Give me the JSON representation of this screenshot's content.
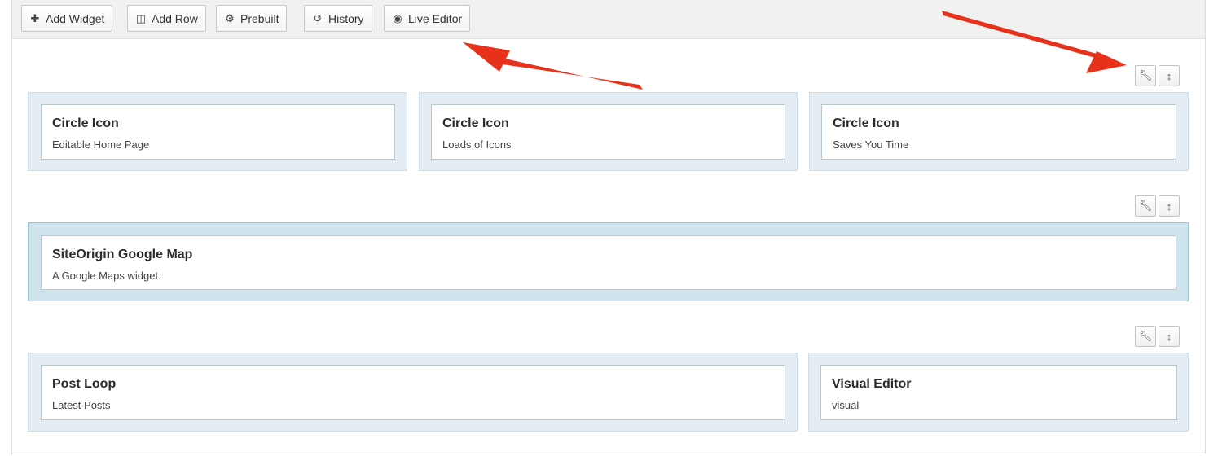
{
  "toolbar": {
    "add_widget": {
      "label": "Add Widget",
      "icon": "plus-icon"
    },
    "add_row": {
      "label": "Add Row",
      "icon": "columns-icon"
    },
    "prebuilt": {
      "label": "Prebuilt",
      "icon": "layout-icon"
    },
    "history": {
      "label": "History",
      "icon": "undo-icon"
    },
    "live_editor": {
      "label": "Live Editor",
      "icon": "eye-icon"
    }
  },
  "row_controls": {
    "edit_icon": "wrench-icon",
    "move_icon": "move-vertical-icon"
  },
  "rows": [
    {
      "cells": [
        {
          "title": "Circle Icon",
          "description": "Editable Home Page"
        },
        {
          "title": "Circle Icon",
          "description": "Loads of Icons"
        },
        {
          "title": "Circle Icon",
          "description": "Saves You Time"
        }
      ]
    },
    {
      "cells": [
        {
          "title": "SiteOrigin Google Map",
          "description": "A Google Maps widget."
        }
      ]
    },
    {
      "cells": [
        {
          "title": "Post Loop",
          "description": "Latest Posts"
        },
        {
          "title": "Visual Editor",
          "description": "visual"
        }
      ]
    }
  ],
  "annotation_color": "#e8311a"
}
